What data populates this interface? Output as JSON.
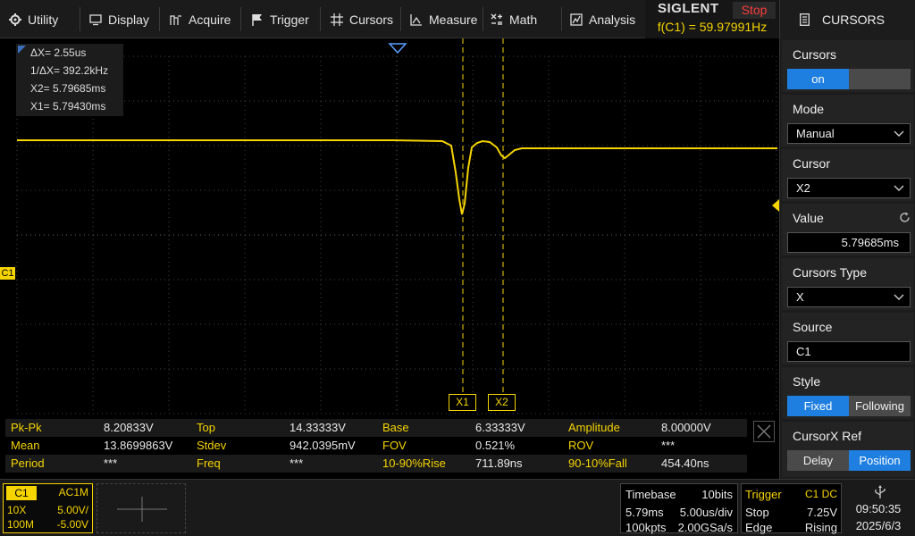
{
  "menu": {
    "utility": "Utility",
    "display": "Display",
    "acquire": "Acquire",
    "trigger": "Trigger",
    "cursors": "Cursors",
    "measure": "Measure",
    "math": "Math",
    "analysis": "Analysis"
  },
  "brand": {
    "logo": "SIGLENT",
    "run_state": "Stop",
    "frequency": "f(C1) = 59.97991Hz"
  },
  "cursor_readout": {
    "dx": "ΔX= 2.55us",
    "inv_dx": "1/ΔX= 392.2kHz",
    "x2": "X2= 5.79685ms",
    "x1": "X1= 5.79430ms"
  },
  "cursor_labels": {
    "x1": "X1",
    "x2": "X2"
  },
  "channel_marker": "C1",
  "panel": {
    "title": "CURSORS",
    "cursors_label": "Cursors",
    "cursors_on": "on",
    "mode_label": "Mode",
    "mode_value": "Manual",
    "cursor_label": "Cursor",
    "cursor_value": "X2",
    "value_label": "Value",
    "value_value": "5.79685ms",
    "type_label": "Cursors Type",
    "type_value": "X",
    "source_label": "Source",
    "source_value": "C1",
    "style_label": "Style",
    "style_fixed": "Fixed",
    "style_following": "Following",
    "ref_label": "CursorX Ref",
    "ref_delay": "Delay",
    "ref_position": "Position"
  },
  "measurements": [
    [
      [
        "Pk-Pk",
        "8.20833V"
      ],
      [
        "Top",
        "14.33333V"
      ],
      [
        "Base",
        "6.33333V"
      ],
      [
        "Amplitude",
        "8.00000V"
      ]
    ],
    [
      [
        "Mean",
        "13.8699863V"
      ],
      [
        "Stdev",
        "942.0395mV"
      ],
      [
        "FOV",
        "0.521%"
      ],
      [
        "ROV",
        "***"
      ]
    ],
    [
      [
        "Period",
        "***"
      ],
      [
        "Freq",
        "***"
      ],
      [
        "10-90%Rise",
        "711.89ns"
      ],
      [
        "90-10%Fall",
        "454.40ns"
      ]
    ]
  ],
  "channel": {
    "name": "C1",
    "coupling": "AC1M",
    "probe": "10X",
    "scale": "5.00V/",
    "bandwidth": "100M",
    "offset": "-5.00V"
  },
  "timebase": {
    "label": "Timebase",
    "bits": "10bits",
    "delay": "5.79ms",
    "scale": "5.00us/div",
    "points": "100kpts",
    "rate": "2.00GSa/s"
  },
  "trigger": {
    "label": "Trigger",
    "source": "C1 DC",
    "mode": "Stop",
    "level": "7.25V",
    "type": "Edge",
    "slope": "Rising"
  },
  "clock": {
    "time": "09:50:35",
    "date": "2025/6/3"
  },
  "colors": {
    "trace": "#f5d400",
    "accent": "#1e7fe0",
    "stop": "#ff3b3b"
  }
}
